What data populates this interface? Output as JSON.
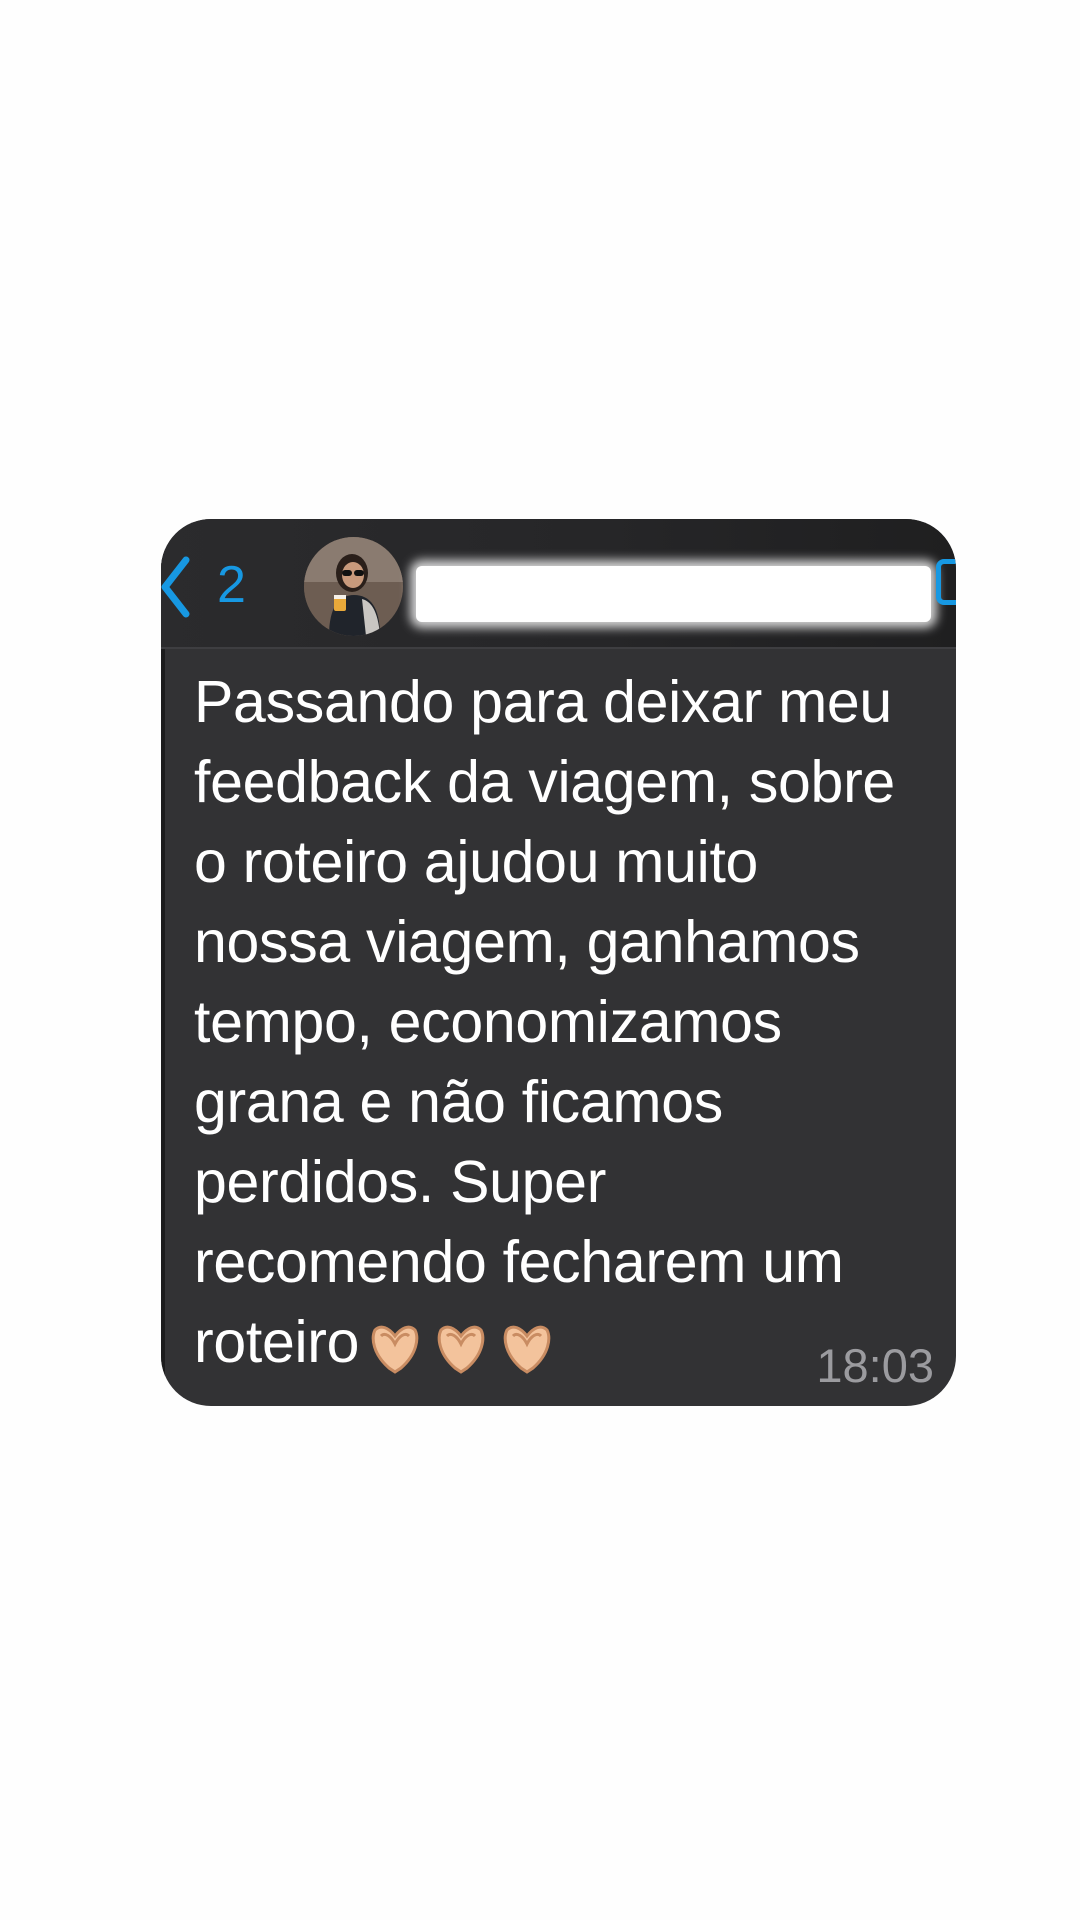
{
  "header": {
    "unread_count": "2",
    "contact_name": "",
    "accent_color": "#1798e2"
  },
  "message": {
    "text": "Passando para deixar meu\nfeedback da viagem, sobre\no roteiro ajudou muito\nnossa viagem, ganhamos\ntempo, economizamos\ngrana e não ficamos\nperdidos. Super\nrecomendo fecharem um\nroteiro",
    "emoji": "heart-hands-emoji",
    "emoji_count": 3,
    "time": "18:03"
  },
  "icons": {
    "back": "chevron-left-icon",
    "avatar": "contact-avatar",
    "right": "video-call-icon"
  }
}
